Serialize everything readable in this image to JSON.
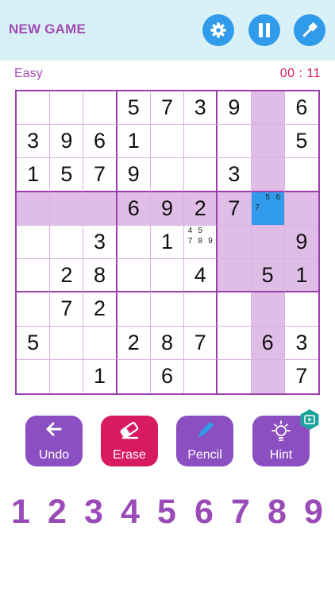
{
  "header": {
    "new_game_label": "NEW GAME",
    "buttons": [
      "settings-icon",
      "pause-icon",
      "magic-wand-icon"
    ]
  },
  "status": {
    "difficulty": "Easy",
    "timer": "00 : 11"
  },
  "colors": {
    "accent": "#a24bb5",
    "header_bg": "#d7f1f6",
    "icon_button": "#2f9bea",
    "timer": "#d81b60",
    "highlight": "#dfbde6",
    "selected": "#2f9bea",
    "erase": "#d81b60",
    "tool": "#8b4fc2",
    "board_border": "#9b3eab",
    "hint_badge": "#1ea39a"
  },
  "board": {
    "cells": [
      [
        "",
        "",
        "",
        "5",
        "7",
        "3",
        "9",
        "",
        "6"
      ],
      [
        "3",
        "9",
        "6",
        "1",
        "",
        "",
        "",
        "",
        "5"
      ],
      [
        "1",
        "5",
        "7",
        "9",
        "",
        "",
        "3",
        "",
        ""
      ],
      [
        "",
        "",
        "",
        "6",
        "9",
        "2",
        "7",
        "",
        ""
      ],
      [
        "",
        "",
        "3",
        "",
        "1",
        "",
        "",
        "",
        "9"
      ],
      [
        "",
        "2",
        "8",
        "",
        "",
        "4",
        "",
        "5",
        "1"
      ],
      [
        "",
        "7",
        "2",
        "",
        "",
        "",
        "",
        "",
        ""
      ],
      [
        "5",
        "",
        "",
        "2",
        "8",
        "7",
        "",
        "6",
        "3"
      ],
      [
        "",
        "",
        "1",
        "",
        "6",
        "",
        "",
        "",
        "7"
      ]
    ],
    "notes": {
      "3-7": [
        "",
        "5",
        "6",
        "7",
        "",
        "",
        "",
        "",
        ""
      ],
      "4-5": [
        "4",
        "5",
        "",
        "7",
        "8",
        "9",
        "",
        "",
        ""
      ]
    },
    "selected": "3-7",
    "highlighted": [
      "0-7",
      "1-7",
      "2-7",
      "3-0",
      "3-1",
      "3-2",
      "3-3",
      "3-4",
      "3-5",
      "3-6",
      "3-8",
      "4-6",
      "4-7",
      "4-8",
      "5-6",
      "5-7",
      "5-8",
      "6-7",
      "7-7",
      "8-7"
    ]
  },
  "tools": [
    {
      "label": "Undo",
      "icon": "arrow-left-icon",
      "color": "#8b4fc2"
    },
    {
      "label": "Erase",
      "icon": "eraser-icon",
      "color": "#d81b60"
    },
    {
      "label": "Pencil",
      "icon": "pencil-icon",
      "color": "#8b4fc2"
    },
    {
      "label": "Hint",
      "icon": "lightbulb-icon",
      "color": "#8b4fc2"
    }
  ],
  "hint_badge_icon": "play-video-icon",
  "numpad": [
    "1",
    "2",
    "3",
    "4",
    "5",
    "6",
    "7",
    "8",
    "9"
  ]
}
